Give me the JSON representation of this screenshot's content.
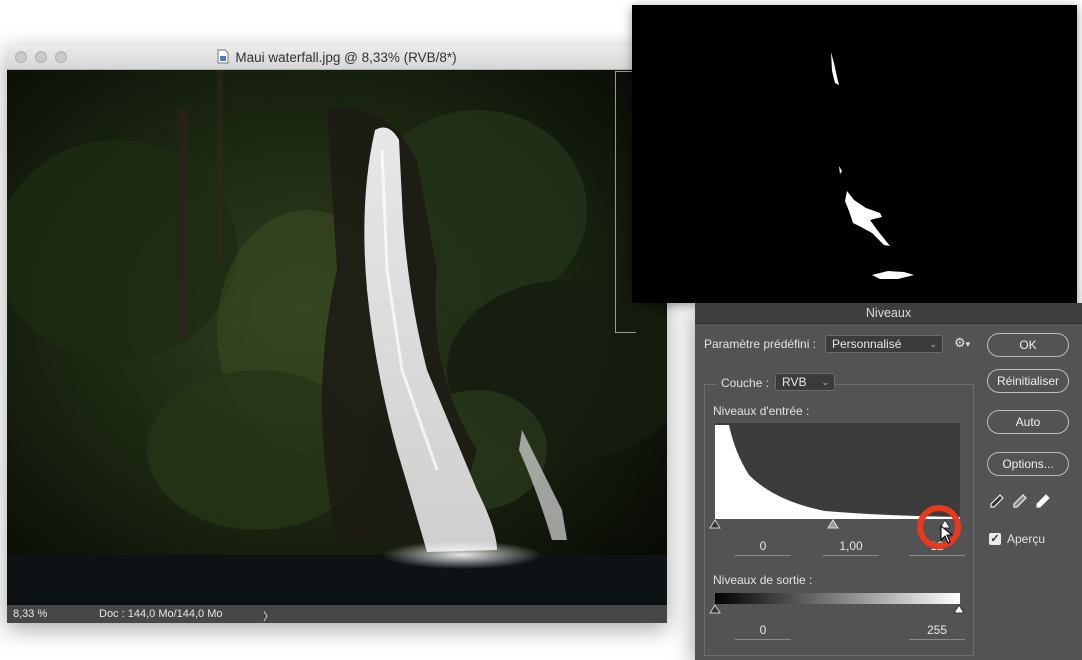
{
  "document": {
    "title": "Maui waterfall.jpg @ 8,33% (RVB/8*)",
    "status_zoom": "8,33 %",
    "status_doc": "Doc : 144,0 Mo/144,0 Mo",
    "status_arrow": "〉",
    "icon": "document-icon"
  },
  "levels": {
    "title": "Niveaux",
    "preset_label": "Paramètre prédéfini :",
    "preset_value": "Personnalisé",
    "channel_label": "Couche :",
    "channel_value": "RVB",
    "input_label": "Niveaux d'entrée :",
    "input_black": "0",
    "input_gamma": "1,00",
    "input_white": "12",
    "output_label": "Niveaux de sortie :",
    "output_black": "0",
    "output_white": "255",
    "preview_label": "Aperçu",
    "preview_checked": true
  },
  "buttons": {
    "ok": "OK",
    "reset": "Réinitialiser",
    "auto": "Auto",
    "options": "Options..."
  },
  "colors": {
    "dialog_bg": "#535353",
    "highlight": "#e8391e"
  }
}
